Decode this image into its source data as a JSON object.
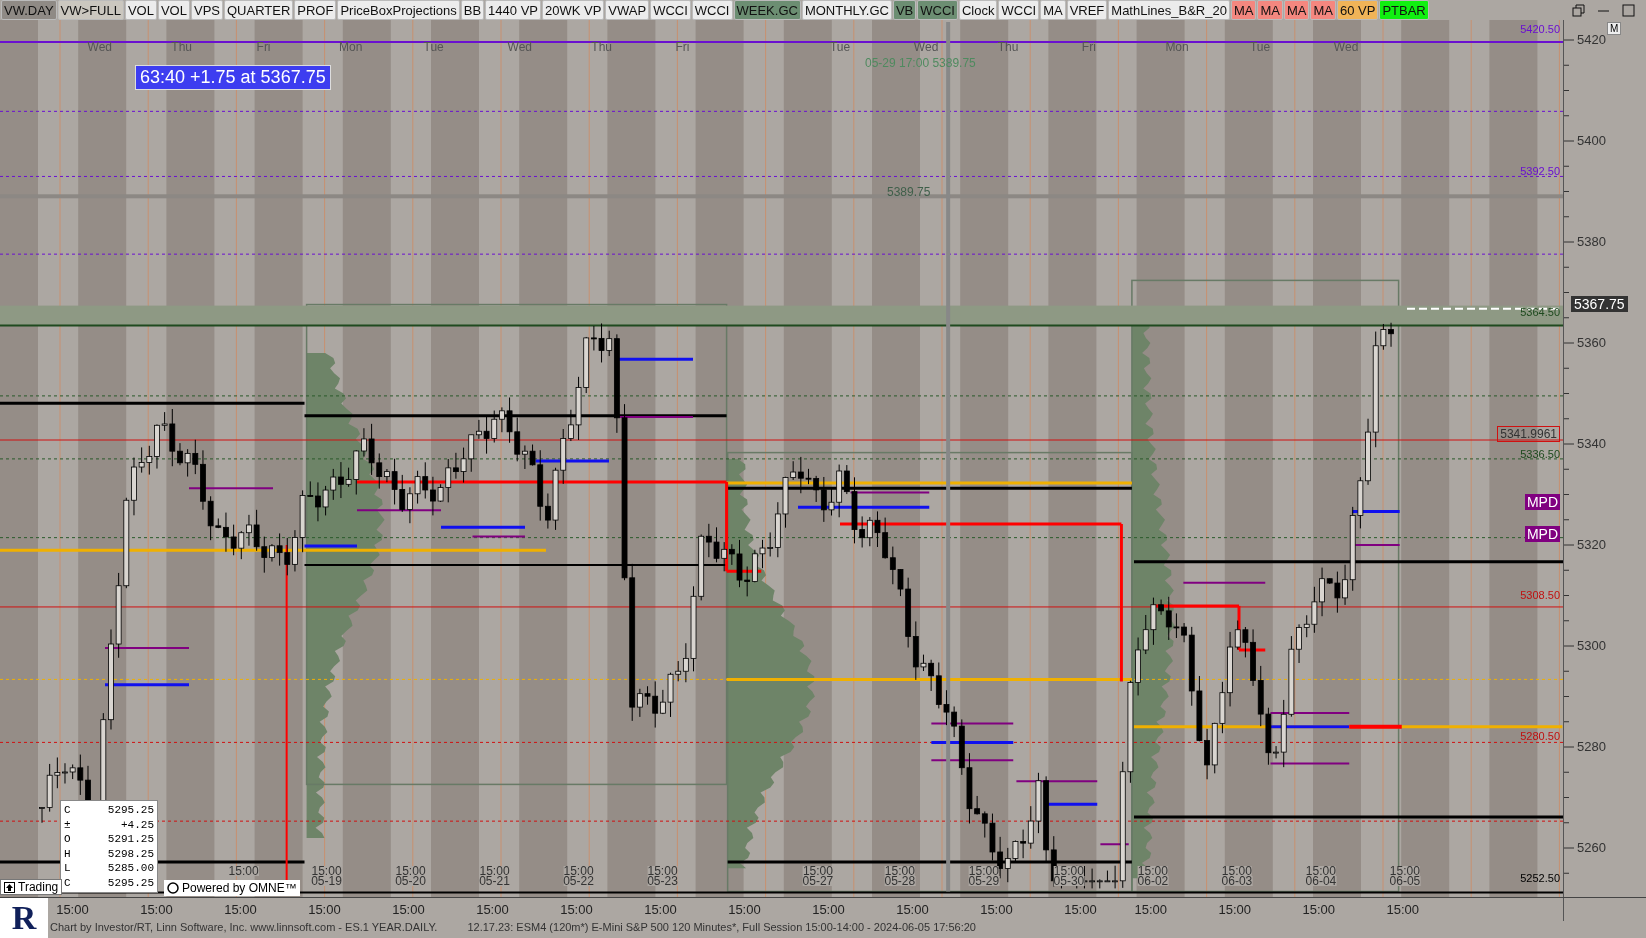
{
  "toolbar": {
    "buttons": [
      {
        "label": "VW.DAY",
        "kind": "selected"
      },
      {
        "label": "VW>FULL",
        "kind": "muted"
      },
      {
        "label": "VOL",
        "kind": "plain"
      },
      {
        "label": "VOL",
        "kind": "plain"
      },
      {
        "label": "VPS",
        "kind": "plain"
      },
      {
        "label": "QUARTER",
        "kind": "plain"
      },
      {
        "label": "PROF",
        "kind": "plain"
      },
      {
        "label": "PriceBoxProjections",
        "kind": "plain"
      },
      {
        "label": "BB",
        "kind": "plain"
      },
      {
        "label": "1440 VP",
        "kind": "plain"
      },
      {
        "label": "20WK VP",
        "kind": "plain"
      },
      {
        "label": "VWAP",
        "kind": "plain"
      },
      {
        "label": "WCCI",
        "kind": "plain"
      },
      {
        "label": "WCCI",
        "kind": "plain"
      },
      {
        "label": "WEEK.GC",
        "kind": "green"
      },
      {
        "label": "MONTHLY.GC",
        "kind": "plain"
      },
      {
        "label": "VB",
        "kind": "green"
      },
      {
        "label": "WCCI",
        "kind": "green"
      },
      {
        "label": "Clock",
        "kind": "plain"
      },
      {
        "label": "WCCI",
        "kind": "plain"
      },
      {
        "label": "MA",
        "kind": "plain"
      },
      {
        "label": "VREF",
        "kind": "plain"
      },
      {
        "label": "MathLines_B&R_20",
        "kind": "plain"
      },
      {
        "label": "MA",
        "kind": "red"
      },
      {
        "label": "MA",
        "kind": "red"
      },
      {
        "label": "MA",
        "kind": "red"
      },
      {
        "label": "MA",
        "kind": "red"
      },
      {
        "label": "60 VP",
        "kind": "orange"
      },
      {
        "label": "PTBAR",
        "kind": "lime"
      }
    ]
  },
  "chart": {
    "day_labels": [
      "Wed",
      "Thu",
      "Fri",
      "Mon",
      "Tue",
      "Wed",
      "Thu",
      "Fri",
      "Tue",
      "Wed",
      "Thu",
      "Fri",
      "Mon",
      "Tue",
      "Wed"
    ],
    "status_box": "63:40  +1.75 at 5367.75",
    "crosshair_readout": "05-29 17:00 5389.75",
    "crosshair_price": "5389.75",
    "level_labels": [
      {
        "text": "5420.50",
        "kind": "purple"
      },
      {
        "text": "5392.50",
        "kind": "purple"
      },
      {
        "text": "5364.50",
        "kind": "green"
      },
      {
        "text": "5341.9961",
        "kind": "boxed"
      },
      {
        "text": "5336.50",
        "kind": "green"
      },
      {
        "text": "MPD",
        "kind": "mpd"
      },
      {
        "text": "MPD",
        "kind": "mpd"
      },
      {
        "text": "5308.50",
        "kind": "red"
      },
      {
        "text": "5280.50",
        "kind": "red"
      },
      {
        "text": "5252.50",
        "kind": "black"
      }
    ],
    "session_labels": [
      {
        "time": "15:00"
      },
      {
        "time": "15:00",
        "date": "05-19"
      },
      {
        "time": "15:00",
        "date": "05-20"
      },
      {
        "time": "15:00",
        "date": "05-21"
      },
      {
        "time": "15:00",
        "date": "05-22"
      },
      {
        "time": "15:00",
        "date": "05-23"
      },
      {
        "time": "15:00",
        "date": "05-27"
      },
      {
        "time": "15:00",
        "date": "05-28"
      },
      {
        "time": "15:00",
        "date": "05-29"
      },
      {
        "time": "15:00",
        "date": "05-30"
      },
      {
        "time": "15:00",
        "date": "06-02"
      },
      {
        "time": "15:00",
        "date": "06-03"
      },
      {
        "time": "15:00",
        "date": "06-04"
      },
      {
        "time": "15:00",
        "date": "06-05"
      }
    ],
    "ohlc": [
      {
        "key": "C",
        "value": "5295.25"
      },
      {
        "key": "±",
        "value": "+4.25"
      },
      {
        "key": "O",
        "value": "5291.25"
      },
      {
        "key": "H",
        "value": "5298.25"
      },
      {
        "key": "L",
        "value": "5285.00"
      },
      {
        "key": "C",
        "value": "5295.25"
      }
    ],
    "trading_button": "Trading",
    "powered_by": "Powered by OMNE™"
  },
  "price_axis": {
    "labels": [
      "5420",
      "5400",
      "5380",
      "5360",
      "5340",
      "5320",
      "5300",
      "5280",
      "5260"
    ],
    "last_price": "5367.75",
    "mode_button": "M"
  },
  "time_axis": [
    "15:00",
    "15:00",
    "15:00",
    "15:00",
    "15:00",
    "15:00",
    "15:00",
    "15:00",
    "15:00",
    "15:00",
    "15:00",
    "15:00",
    "15:00",
    "15:00",
    "15:00",
    "15:00",
    "15:00"
  ],
  "logo": "R",
  "footer": {
    "credit": "Chart by Investor/RT, Linn Software, Inc. www.linnsoft.com - ES.1 YEAR.DAILY.",
    "description": "12.17.23: ESM4 (120m*) E-Mini S&P 500 120 Minutes*, Full Session 15:00-14:00 - 2024-06-05 17:56:20"
  }
}
